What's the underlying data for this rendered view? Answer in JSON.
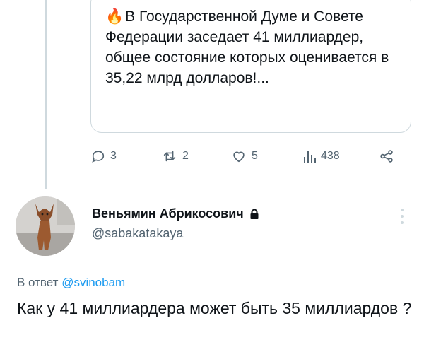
{
  "quoted": {
    "emoji_icon": "fire-icon",
    "text": "В Государственной Думе и Совете Федерации заседает 41 миллиардер, общее состояние которых оценивается в 35,22 млрд долларов!..."
  },
  "actions": {
    "replies": "3",
    "reposts": "2",
    "likes": "5",
    "views": "438"
  },
  "reply_tweet": {
    "author_name": "Веньямин Абрикосович",
    "author_handle": "@sabakatakaya",
    "reply_prefix": "В ответ",
    "reply_handle": "@svinobam",
    "text": "Как у 41 миллиардера может быть 35 миллиардов ?"
  },
  "colors": {
    "text_primary": "#0f1419",
    "text_secondary": "#536471",
    "link": "#1d9bf0",
    "border": "#cfd9de"
  }
}
